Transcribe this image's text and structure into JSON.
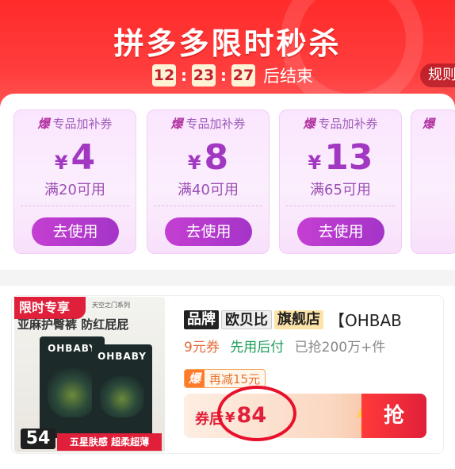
{
  "header": {
    "title": "拼多多限时秒杀",
    "countdown": {
      "hours": "12",
      "minutes": "23",
      "seconds": "27",
      "sep": ":",
      "suffix": "后结束"
    },
    "rules_label": "规则"
  },
  "coupons": [
    {
      "tag_bao": "爆",
      "tag_text": "专品加补券",
      "currency": "¥",
      "amount": "4",
      "condition": "满20可用",
      "button": "去使用"
    },
    {
      "tag_bao": "爆",
      "tag_text": "专品加补券",
      "currency": "¥",
      "amount": "8",
      "condition": "满40可用",
      "button": "去使用"
    },
    {
      "tag_bao": "爆",
      "tag_text": "专品加补券",
      "currency": "¥",
      "amount": "13",
      "condition": "满65可用",
      "button": "去使用"
    }
  ],
  "product": {
    "badge": "限时专享",
    "series": "天空之门系列",
    "strip_text": "亚麻护臀裤  防红屁屁",
    "box_brand": "OHBABY",
    "image_price": "54",
    "image_footer": "五星肤感 超柔超薄",
    "brand_chips": [
      "品牌",
      "欧贝比",
      "旗舰店"
    ],
    "title": "【OHBAB",
    "tags": [
      "9元券",
      "先用后付",
      "已抢200万+件"
    ],
    "reduce_bao": "爆",
    "reduce_text": "再减15元",
    "coupon_label": "券后",
    "currency": "¥",
    "price": "84",
    "grab_label": "抢"
  },
  "colors": {
    "accent": "#e0203a",
    "coupon_purple": "#a238c2"
  }
}
